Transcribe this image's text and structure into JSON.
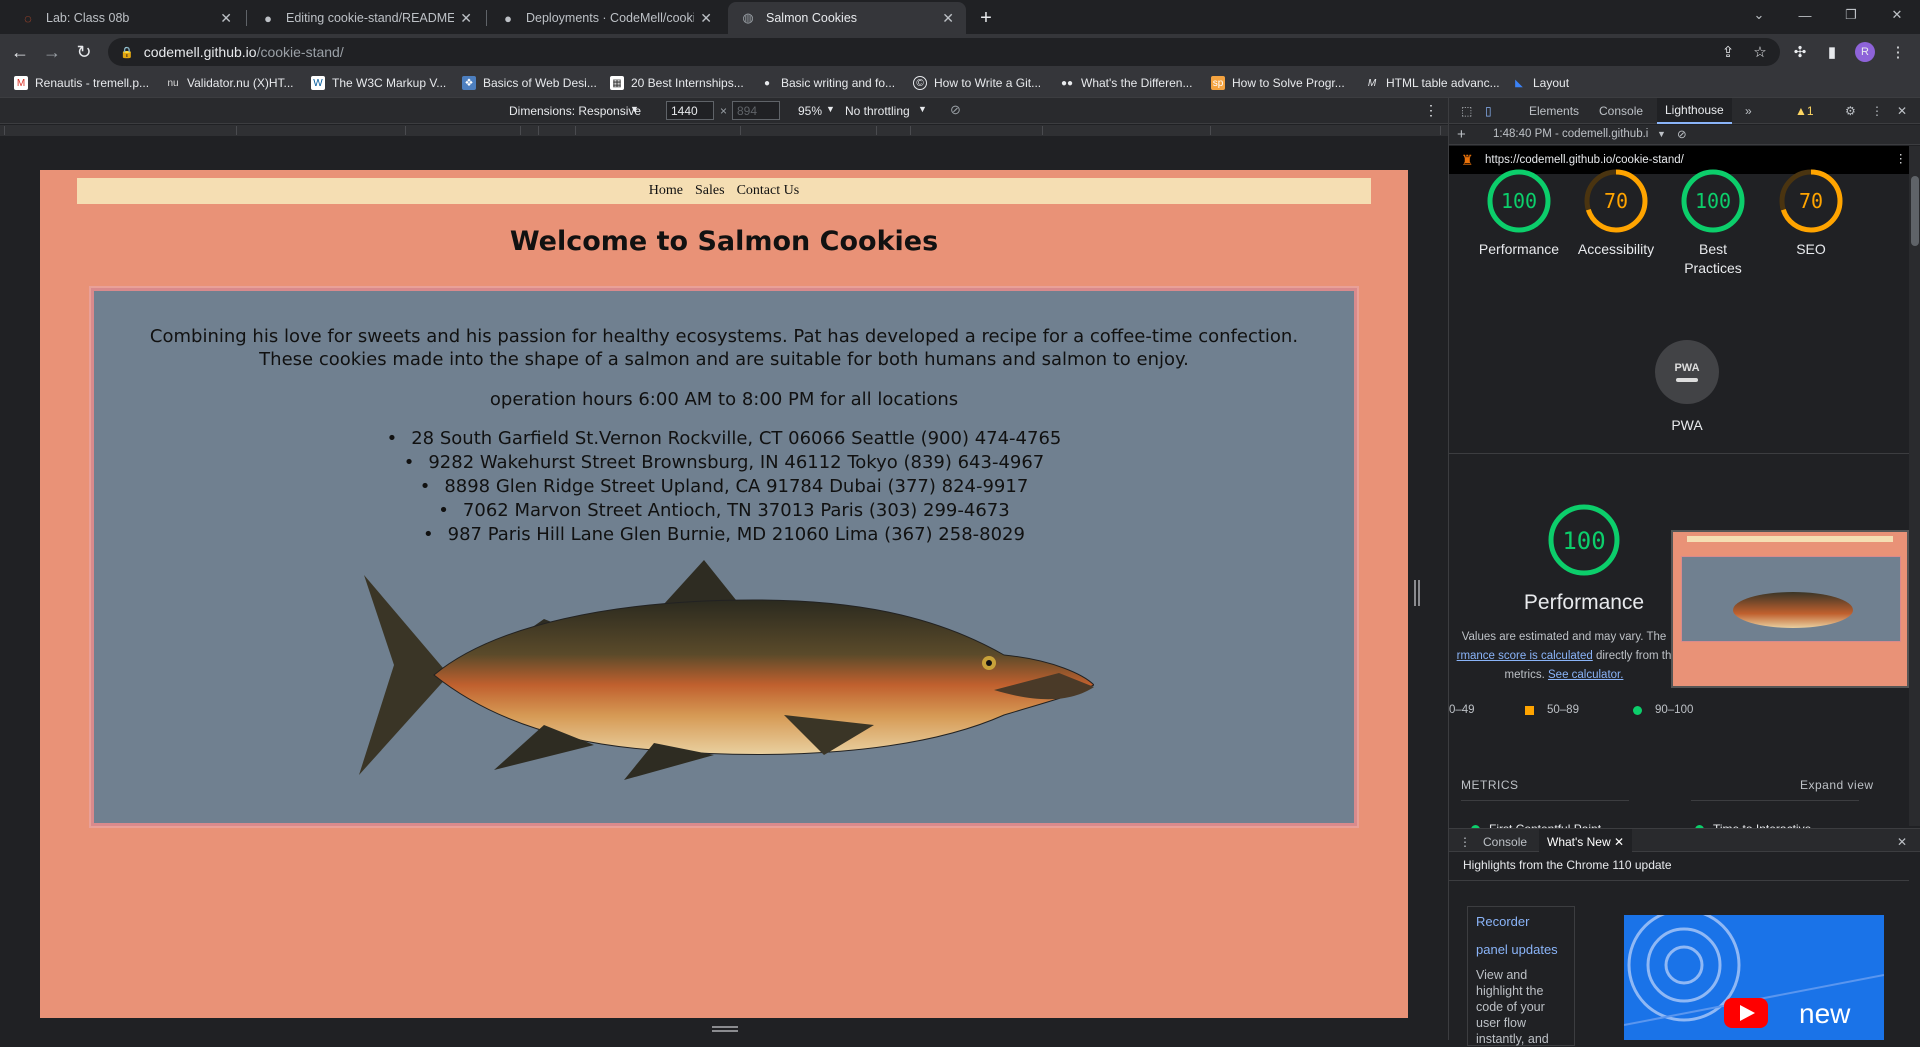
{
  "tabs": [
    {
      "title": "Lab: Class 08b",
      "icon": "canvas-icon",
      "active": false
    },
    {
      "title": "Editing cookie-stand/README.m",
      "icon": "github-icon",
      "active": false
    },
    {
      "title": "Deployments · CodeMell/cookie-",
      "icon": "github-icon",
      "active": false
    },
    {
      "title": "Salmon Cookies",
      "icon": "globe-icon",
      "active": true
    }
  ],
  "address": {
    "host": "codemell.github.io",
    "path": "/cookie-stand/"
  },
  "bookmarks": [
    "Renautis - tremell.p...",
    "Validator.nu (X)HT...",
    "The W3C Markup V...",
    "Basics of Web Desi...",
    "20 Best Internships...",
    "Basic writing and fo...",
    "How to Write a Git...",
    "What's the Differen...",
    "How to Solve Progr...",
    "HTML table advanc...",
    "Layout"
  ],
  "device_toolbar": {
    "dimensions": "Dimensions: Responsive",
    "width": "1440",
    "height_placeholder": "894",
    "zoom": "95%",
    "throttling": "No throttling"
  },
  "site": {
    "nav": [
      "Home",
      "Sales",
      "Contact Us"
    ],
    "heading": "Welcome to Salmon Cookies",
    "description": "Combining his love for sweets and his passion for healthy ecosystems. Pat has developed a recipe for a coffee-time confection. These cookies made into the shape of a salmon and are suitable for both humans and salmon to enjoy.",
    "hours": "operation hours 6:00 AM to 8:00 PM for all locations",
    "locations": [
      "28 South Garfield St.Vernon Rockville, CT 06066 Seattle (900) 474-4765",
      "9282 Wakehurst Street Brownsburg, IN 46112 Tokyo (839) 643-4967",
      "8898 Glen Ridge Street Upland, CA 91784 Dubai (377) 824-9917",
      "7062 Marvon Street Antioch, TN 37013 Paris (303) 299-4673",
      "987 Paris Hill Lane Glen Burnie, MD 21060 Lima (367) 258-8029"
    ]
  },
  "devtools": {
    "tabs": [
      "Elements",
      "Console",
      "Lighthouse"
    ],
    "active_tab": "Lighthouse",
    "warning_count": "1",
    "report_time": "1:48:40 PM - codemell.github.i",
    "report_url": "https://codemell.github.io/cookie-stand/",
    "scores": [
      {
        "label": "Performance",
        "value": "100",
        "fraction": 1.0,
        "color": "#0cce6b"
      },
      {
        "label": "Accessibility",
        "value": "70",
        "fraction": 0.7,
        "color": "#ffa400"
      },
      {
        "label": "Best Practices",
        "value": "100",
        "fraction": 1.0,
        "color": "#0cce6b"
      },
      {
        "label": "SEO",
        "value": "70",
        "fraction": 0.7,
        "color": "#ffa400"
      }
    ],
    "pwa_label": "PWA",
    "pwa_badge": "PWA",
    "perf_big_value": "100",
    "perf_big_label": "Performance",
    "perf_note_1": "Values are estimated and may vary. The",
    "perf_note_link": "rmance score is calculated",
    "perf_note_2": "directly from th",
    "perf_note_3": "metrics.",
    "perf_note_calc": "See calculator.",
    "legend": [
      "0–49",
      "50–89",
      "90–100"
    ],
    "metrics_header": "METRICS",
    "expand_view": "Expand view",
    "metric_1": "First Contentful Paint",
    "metric_2": "Time to Interactive",
    "drawer_tabs": [
      "Console",
      "What's New"
    ],
    "drawer_title": "Highlights from the Chrome 110 update",
    "news_title_1": "Recorder",
    "news_title_2": "panel updates",
    "news_body": "View and highlight the code of your user flow instantly, and",
    "news_img_text": "new"
  }
}
